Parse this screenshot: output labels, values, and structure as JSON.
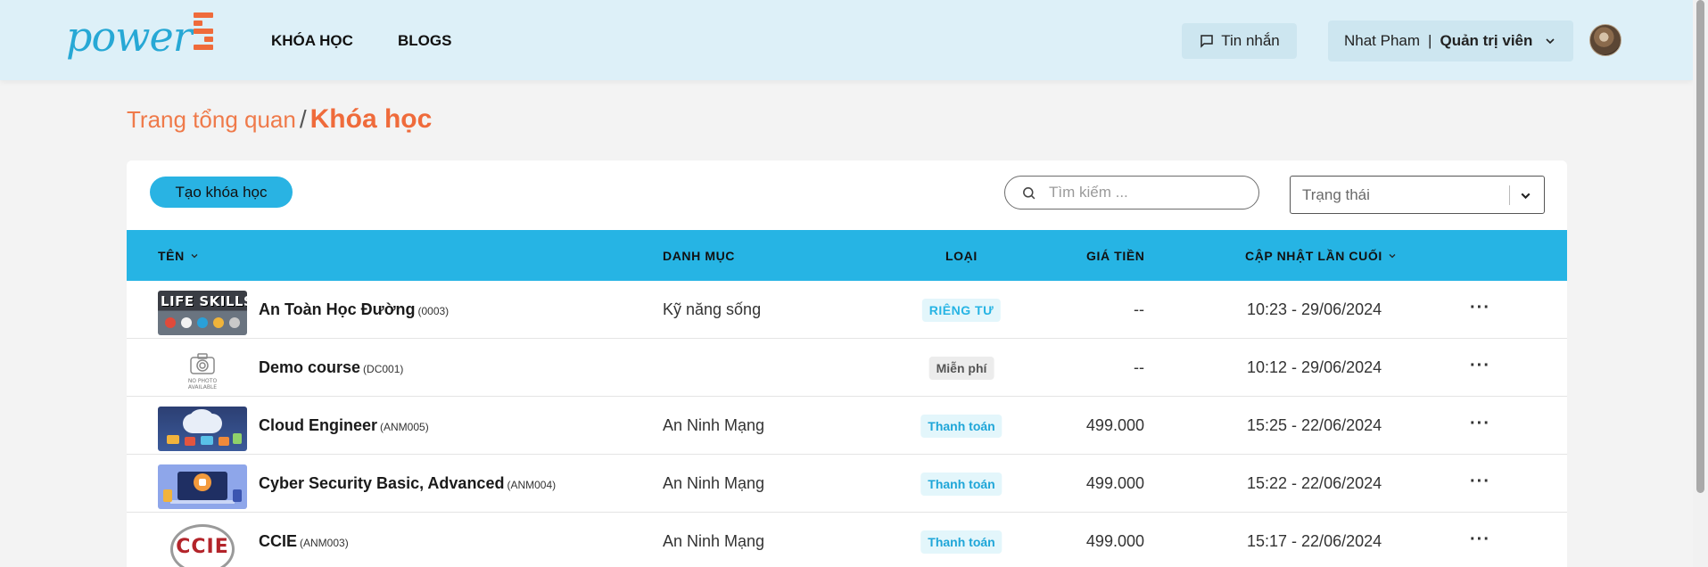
{
  "header": {
    "logo_text": "power",
    "nav": [
      {
        "label": "KHÓA HỌC"
      },
      {
        "label": "BLOGS"
      }
    ],
    "messages_label": "Tin nhắn",
    "user_name": "Nhat Pham",
    "user_separator": "|",
    "user_role": "Quản trị viên"
  },
  "breadcrumb": {
    "parent": "Trang tổng quan",
    "separator": "/",
    "current": "Khóa học"
  },
  "toolbar": {
    "create_label": "Tạo khóa học",
    "search_placeholder": "Tìm kiếm ...",
    "status_placeholder": "Trạng thái"
  },
  "table": {
    "headers": {
      "name": "TÊN",
      "category": "DANH MỤC",
      "type": "LOẠI",
      "price": "GIÁ TIỀN",
      "updated": "CẬP NHẬT LẦN CUỐI"
    },
    "rows": [
      {
        "name": "An Toàn Học Đường",
        "code": "(0003)",
        "category": "Kỹ năng sống",
        "type": "RIÊNG TƯ",
        "type_kind": "private",
        "price": "--",
        "updated": "10:23 - 29/06/2024",
        "thumb_text": "LIFE SKILLS"
      },
      {
        "name": "Demo course",
        "code": "(DC001)",
        "category": "",
        "type": "Miễn phí",
        "type_kind": "free",
        "price": "--",
        "updated": "10:12 - 29/06/2024",
        "thumb_text": "NO PHOTO AVAILABLE"
      },
      {
        "name": "Cloud Engineer",
        "code": "(ANM005)",
        "category": "An Ninh Mạng",
        "type": "Thanh toán",
        "type_kind": "paid",
        "price": "499.000",
        "updated": "15:25 - 22/06/2024",
        "thumb_text": ""
      },
      {
        "name": "Cyber Security Basic, Advanced",
        "code": "(ANM004)",
        "category": "An Ninh Mạng",
        "type": "Thanh toán",
        "type_kind": "paid",
        "price": "499.000",
        "updated": "15:22 - 22/06/2024",
        "thumb_text": ""
      },
      {
        "name": "CCIE",
        "code": "(ANM003)",
        "category": "An Ninh Mạng",
        "type": "Thanh toán",
        "type_kind": "paid",
        "price": "499.000",
        "updated": "15:17 - 22/06/2024",
        "thumb_text": "CCIE"
      }
    ],
    "row_actions": "···"
  },
  "colors": {
    "accent_blue": "#26b4e4",
    "accent_orange": "#ef6b3b",
    "header_bg": "#ddf0f8"
  }
}
